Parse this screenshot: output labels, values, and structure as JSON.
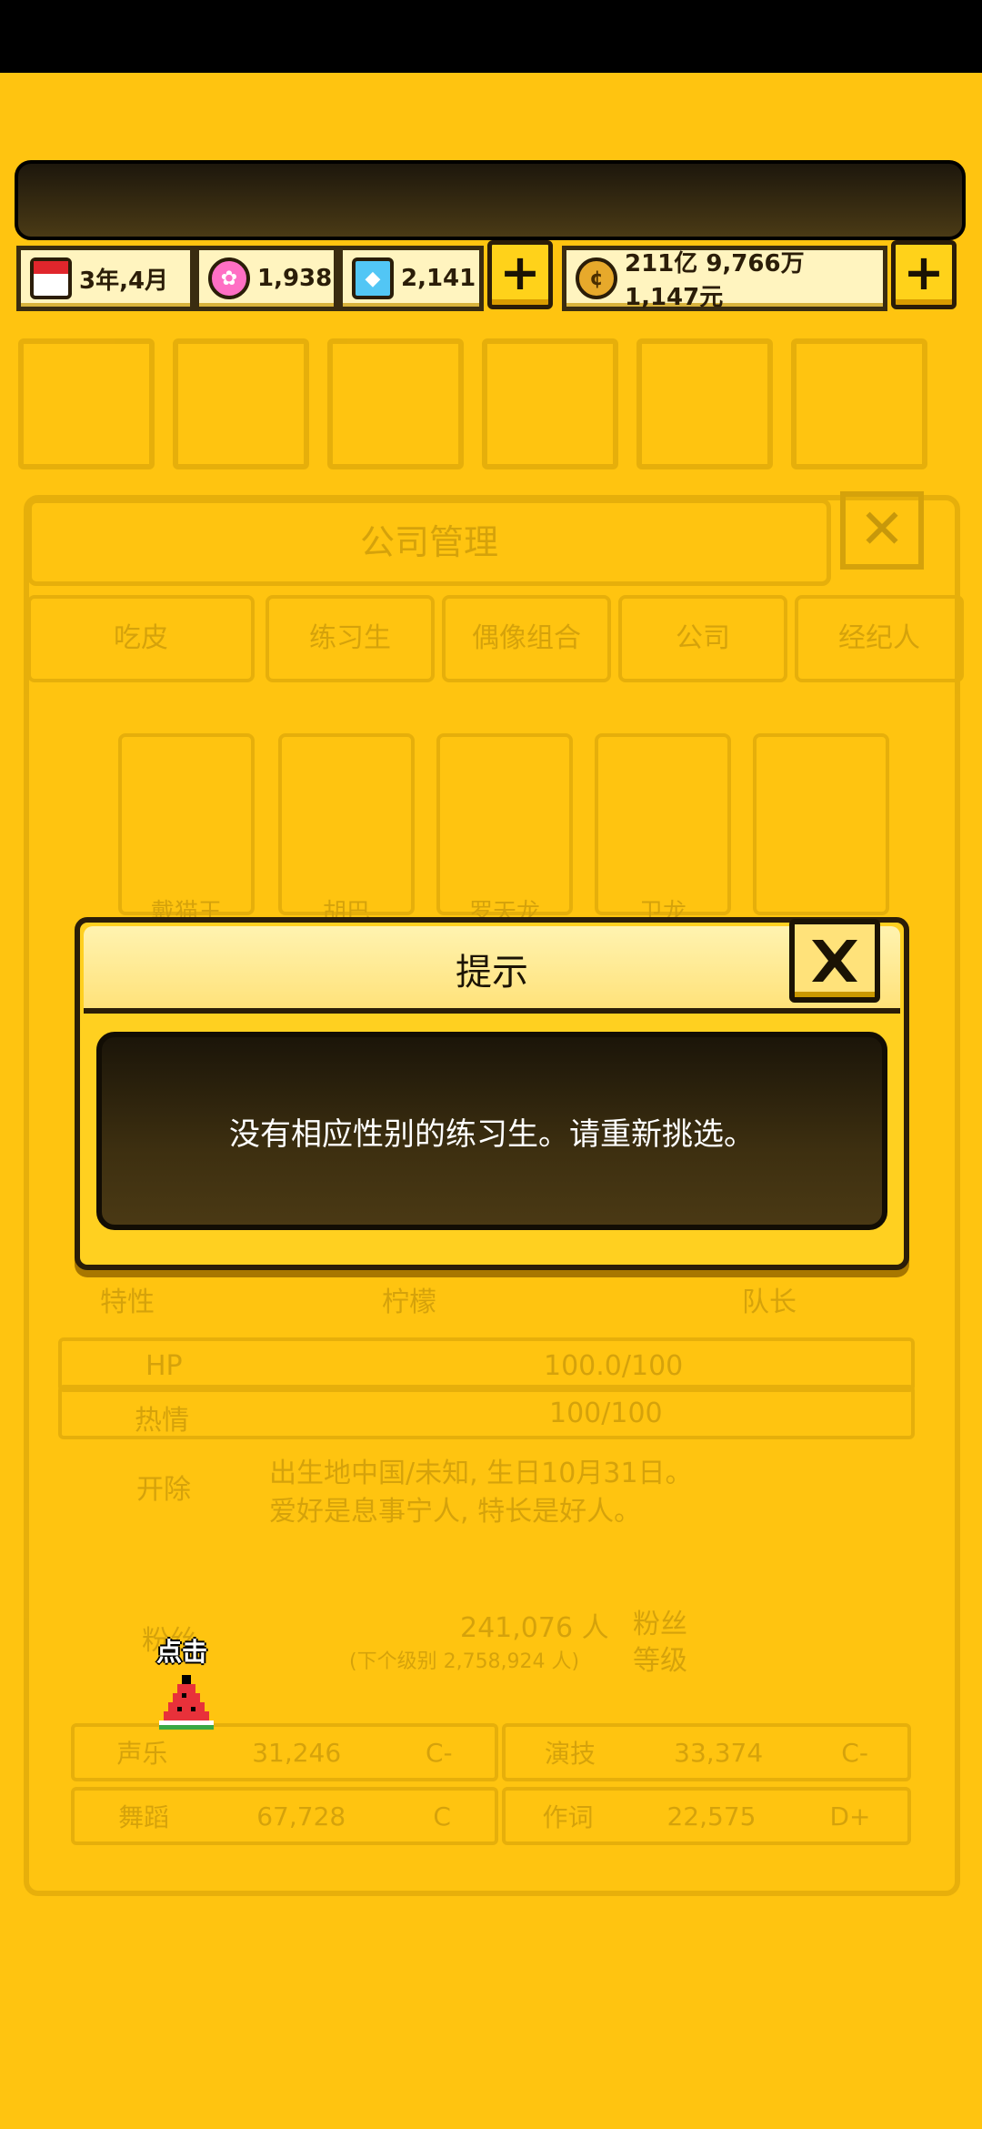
{
  "resources": {
    "date": "3年,4月",
    "pink_gems": "1,938",
    "blue_gems": "2,141",
    "money": "211亿 9,766万 1,147元"
  },
  "background": {
    "panel_title": "公司管理",
    "tabs": [
      "吃皮",
      "练习生",
      "偶像组合",
      "公司",
      "经纪人"
    ],
    "members": [
      "戴猫王",
      "胡巴",
      "罗天龙",
      "卫龙"
    ],
    "trait_label": "特性",
    "trait_value": "柠檬",
    "leader_label": "队长",
    "hp_label": "HP",
    "hp_value": "100.0/100",
    "passion_label": "热情",
    "passion_value": "100/100",
    "fire_button": "开除",
    "bio_line1": "出生地中国/未知, 生日10月31日。",
    "bio_line2": "爱好是息事宁人, 特长是好人。",
    "fans_label": "粉丝",
    "fans_count": "241,076 人",
    "fans_next": "(下个级别 2,758,924 人)",
    "fan_level_label_1": "粉丝",
    "fan_level_label_2": "等级",
    "stats": [
      {
        "label": "声乐",
        "value": "31,246",
        "grade": "C-"
      },
      {
        "label": "演技",
        "value": "33,374",
        "grade": "C-"
      },
      {
        "label": "舞蹈",
        "value": "67,728",
        "grade": "C"
      },
      {
        "label": "作词",
        "value": "22,575",
        "grade": "D+"
      }
    ]
  },
  "dialog": {
    "title": "提示",
    "message": "没有相应性别的练习生。请重新挑选。"
  },
  "hint": {
    "label": "点击"
  },
  "colors": {
    "background": "#ffc410",
    "dialog": "#ffd020",
    "message_box": "#2b2210"
  }
}
